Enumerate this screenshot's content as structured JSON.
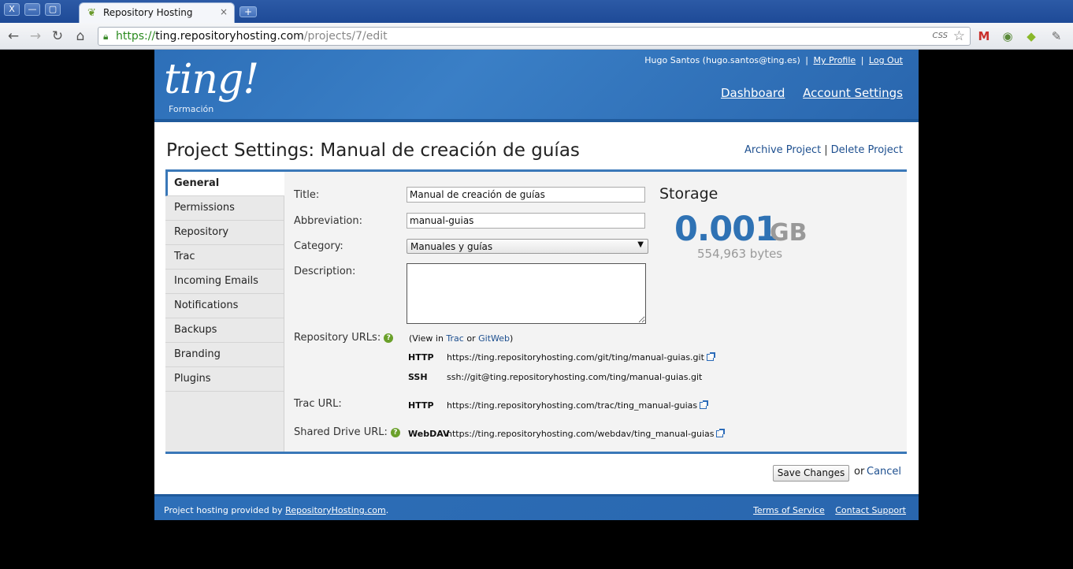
{
  "browser": {
    "window_buttons": [
      "X",
      "—",
      "▢"
    ],
    "tab_title": "Repository Hosting",
    "tab_close": "×",
    "new_tab": "+",
    "url_scheme": "https://",
    "url_host": "ting.repositoryhosting.com",
    "url_path": "/projects/7/edit",
    "css_indicator": "CSS"
  },
  "header": {
    "logo": "ting!",
    "org": "Formación",
    "user": "Hugo Santos (hugo.santos@ting.es)",
    "my_profile": "My Profile",
    "log_out": "Log Out",
    "separator": "|",
    "nav": [
      "Dashboard",
      "Account Settings"
    ]
  },
  "page": {
    "title": "Project Settings: Manual de creación de guías",
    "archive": "Archive Project",
    "delete": "Delete Project",
    "separator": "|"
  },
  "sidebar": {
    "items": [
      {
        "label": "General"
      },
      {
        "label": "Permissions"
      },
      {
        "label": "Repository"
      },
      {
        "label": "Trac"
      },
      {
        "label": "Incoming Emails"
      },
      {
        "label": "Notifications"
      },
      {
        "label": "Backups"
      },
      {
        "label": "Branding"
      },
      {
        "label": "Plugins"
      }
    ],
    "active": "General"
  },
  "form": {
    "title_label": "Title:",
    "title_value": "Manual de creación de guías",
    "abbr_label": "Abbreviation:",
    "abbr_value": "manual-guias",
    "category_label": "Category:",
    "category_value": "Manuales y guías",
    "description_label": "Description:",
    "description_value": "",
    "repo_urls_label": "Repository URLs:",
    "view_in_prefix": "(View in",
    "view_in_trac": "Trac",
    "view_in_or": "or",
    "view_in_gitweb": "GitWeb",
    "view_in_suffix": ")",
    "repo_http_proto": "HTTP",
    "repo_http_url": "https://ting.repositoryhosting.com/git/ting/manual-guias.git",
    "repo_ssh_proto": "SSH",
    "repo_ssh_url": "ssh://git@ting.repositoryhosting.com/ting/manual-guias.git",
    "trac_label": "Trac URL:",
    "trac_proto": "HTTP",
    "trac_url": "https://ting.repositoryhosting.com/trac/ting_manual-guias",
    "drive_label": "Shared Drive URL:",
    "drive_proto": "WebDAV",
    "drive_url": "https://ting.repositoryhosting.com/webdav/ting_manual-guias",
    "help_glyph": "?"
  },
  "storage": {
    "heading": "Storage",
    "value": "0.001",
    "unit": "GB",
    "bytes": "554,963 bytes"
  },
  "actions": {
    "save": "Save Changes",
    "or": "or",
    "cancel": "Cancel"
  },
  "footer": {
    "text": "Project hosting provided by",
    "link": "RepositoryHosting.com",
    "period": ".",
    "terms": "Terms of Service",
    "support": "Contact Support"
  },
  "colors": {
    "header_blue": "#2d6fb8",
    "accent": "#3a78b8",
    "link": "#1d4f8f",
    "help_green": "#6aa02a"
  }
}
